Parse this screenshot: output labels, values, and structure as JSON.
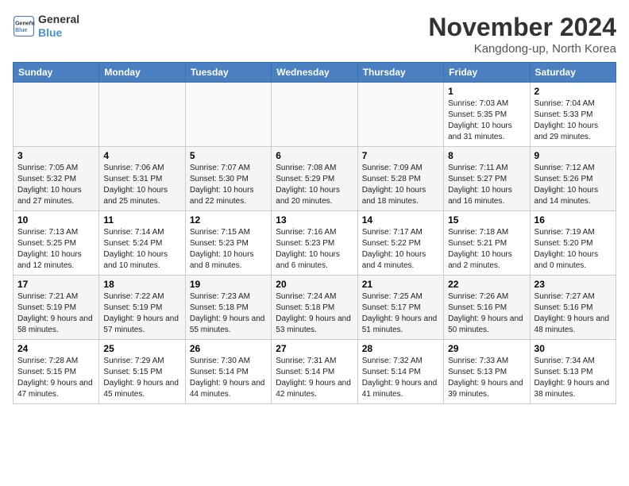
{
  "logo": {
    "line1": "General",
    "line2": "Blue"
  },
  "title": "November 2024",
  "location": "Kangdong-up, North Korea",
  "days_header": [
    "Sunday",
    "Monday",
    "Tuesday",
    "Wednesday",
    "Thursday",
    "Friday",
    "Saturday"
  ],
  "weeks": [
    [
      {
        "day": "",
        "info": ""
      },
      {
        "day": "",
        "info": ""
      },
      {
        "day": "",
        "info": ""
      },
      {
        "day": "",
        "info": ""
      },
      {
        "day": "",
        "info": ""
      },
      {
        "day": "1",
        "info": "Sunrise: 7:03 AM\nSunset: 5:35 PM\nDaylight: 10 hours and 31 minutes."
      },
      {
        "day": "2",
        "info": "Sunrise: 7:04 AM\nSunset: 5:33 PM\nDaylight: 10 hours and 29 minutes."
      }
    ],
    [
      {
        "day": "3",
        "info": "Sunrise: 7:05 AM\nSunset: 5:32 PM\nDaylight: 10 hours and 27 minutes."
      },
      {
        "day": "4",
        "info": "Sunrise: 7:06 AM\nSunset: 5:31 PM\nDaylight: 10 hours and 25 minutes."
      },
      {
        "day": "5",
        "info": "Sunrise: 7:07 AM\nSunset: 5:30 PM\nDaylight: 10 hours and 22 minutes."
      },
      {
        "day": "6",
        "info": "Sunrise: 7:08 AM\nSunset: 5:29 PM\nDaylight: 10 hours and 20 minutes."
      },
      {
        "day": "7",
        "info": "Sunrise: 7:09 AM\nSunset: 5:28 PM\nDaylight: 10 hours and 18 minutes."
      },
      {
        "day": "8",
        "info": "Sunrise: 7:11 AM\nSunset: 5:27 PM\nDaylight: 10 hours and 16 minutes."
      },
      {
        "day": "9",
        "info": "Sunrise: 7:12 AM\nSunset: 5:26 PM\nDaylight: 10 hours and 14 minutes."
      }
    ],
    [
      {
        "day": "10",
        "info": "Sunrise: 7:13 AM\nSunset: 5:25 PM\nDaylight: 10 hours and 12 minutes."
      },
      {
        "day": "11",
        "info": "Sunrise: 7:14 AM\nSunset: 5:24 PM\nDaylight: 10 hours and 10 minutes."
      },
      {
        "day": "12",
        "info": "Sunrise: 7:15 AM\nSunset: 5:23 PM\nDaylight: 10 hours and 8 minutes."
      },
      {
        "day": "13",
        "info": "Sunrise: 7:16 AM\nSunset: 5:23 PM\nDaylight: 10 hours and 6 minutes."
      },
      {
        "day": "14",
        "info": "Sunrise: 7:17 AM\nSunset: 5:22 PM\nDaylight: 10 hours and 4 minutes."
      },
      {
        "day": "15",
        "info": "Sunrise: 7:18 AM\nSunset: 5:21 PM\nDaylight: 10 hours and 2 minutes."
      },
      {
        "day": "16",
        "info": "Sunrise: 7:19 AM\nSunset: 5:20 PM\nDaylight: 10 hours and 0 minutes."
      }
    ],
    [
      {
        "day": "17",
        "info": "Sunrise: 7:21 AM\nSunset: 5:19 PM\nDaylight: 9 hours and 58 minutes."
      },
      {
        "day": "18",
        "info": "Sunrise: 7:22 AM\nSunset: 5:19 PM\nDaylight: 9 hours and 57 minutes."
      },
      {
        "day": "19",
        "info": "Sunrise: 7:23 AM\nSunset: 5:18 PM\nDaylight: 9 hours and 55 minutes."
      },
      {
        "day": "20",
        "info": "Sunrise: 7:24 AM\nSunset: 5:18 PM\nDaylight: 9 hours and 53 minutes."
      },
      {
        "day": "21",
        "info": "Sunrise: 7:25 AM\nSunset: 5:17 PM\nDaylight: 9 hours and 51 minutes."
      },
      {
        "day": "22",
        "info": "Sunrise: 7:26 AM\nSunset: 5:16 PM\nDaylight: 9 hours and 50 minutes."
      },
      {
        "day": "23",
        "info": "Sunrise: 7:27 AM\nSunset: 5:16 PM\nDaylight: 9 hours and 48 minutes."
      }
    ],
    [
      {
        "day": "24",
        "info": "Sunrise: 7:28 AM\nSunset: 5:15 PM\nDaylight: 9 hours and 47 minutes."
      },
      {
        "day": "25",
        "info": "Sunrise: 7:29 AM\nSunset: 5:15 PM\nDaylight: 9 hours and 45 minutes."
      },
      {
        "day": "26",
        "info": "Sunrise: 7:30 AM\nSunset: 5:14 PM\nDaylight: 9 hours and 44 minutes."
      },
      {
        "day": "27",
        "info": "Sunrise: 7:31 AM\nSunset: 5:14 PM\nDaylight: 9 hours and 42 minutes."
      },
      {
        "day": "28",
        "info": "Sunrise: 7:32 AM\nSunset: 5:14 PM\nDaylight: 9 hours and 41 minutes."
      },
      {
        "day": "29",
        "info": "Sunrise: 7:33 AM\nSunset: 5:13 PM\nDaylight: 9 hours and 39 minutes."
      },
      {
        "day": "30",
        "info": "Sunrise: 7:34 AM\nSunset: 5:13 PM\nDaylight: 9 hours and 38 minutes."
      }
    ]
  ]
}
